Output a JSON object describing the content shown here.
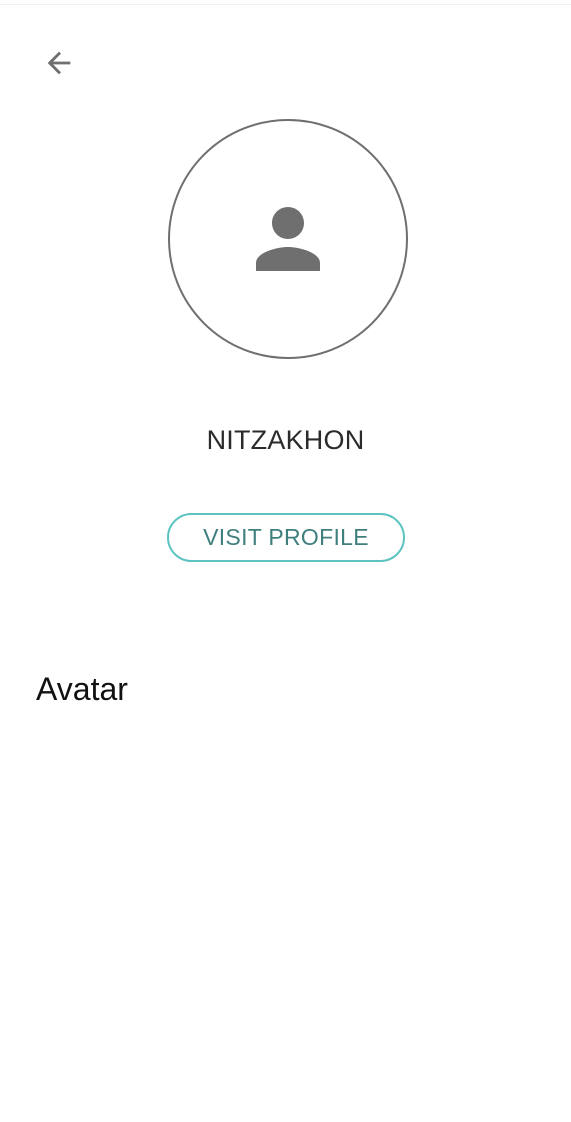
{
  "icons": {
    "back": "arrow-left-icon",
    "avatar": "person-icon"
  },
  "colors": {
    "icon": "#6f6f6f",
    "button_border": "#5cc3c0",
    "button_text": "#3f7f7d",
    "title_text": "#111111"
  },
  "profile": {
    "username": "NITZAKHON",
    "visit_label": "VISIT PROFILE"
  },
  "section": {
    "title": "Avatar"
  }
}
